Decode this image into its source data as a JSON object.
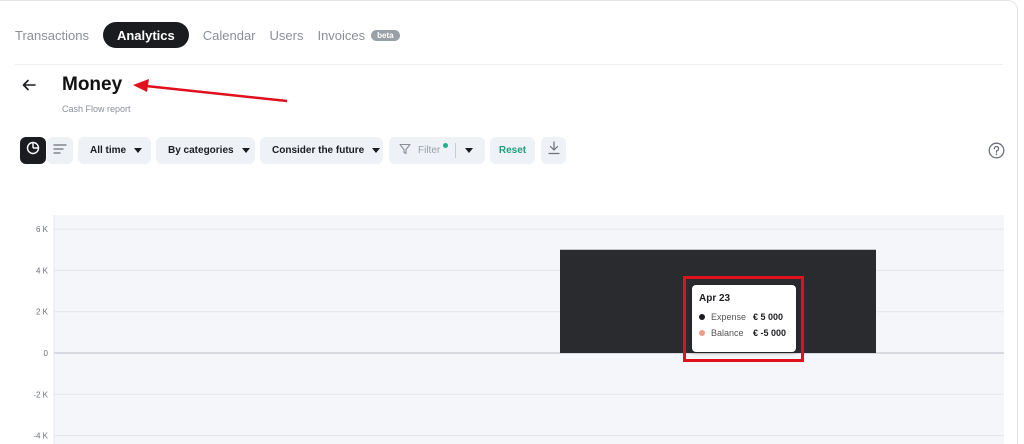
{
  "nav": {
    "items": [
      {
        "label": "Transactions",
        "active": false
      },
      {
        "label": "Analytics",
        "active": true
      },
      {
        "label": "Calendar",
        "active": false
      },
      {
        "label": "Users",
        "active": false
      },
      {
        "label": "Invoices",
        "active": false,
        "badge": "beta"
      }
    ]
  },
  "header": {
    "back_icon": "arrow-left-icon",
    "title": "Money",
    "subtitle": "Cash Flow report"
  },
  "toolbar": {
    "view_modes": [
      {
        "icon": "pie-chart-icon",
        "active": true
      },
      {
        "icon": "list-icon",
        "active": false
      }
    ],
    "dropdowns": [
      {
        "label": "All time"
      },
      {
        "label": "By categories"
      },
      {
        "label": "Consider the future"
      }
    ],
    "filter_label": "Filter",
    "filter_indicator_color": "#21b08a",
    "reset_label": "Reset",
    "download_icon": "download-icon",
    "help_icon": "help-circle-icon"
  },
  "colors": {
    "accent": "#21a07a",
    "expense": "#1b1c1f",
    "balance": "#ef9a8a",
    "annotation": "#e0101d"
  },
  "chart_data": {
    "type": "bar",
    "y_ticks": [
      "6 K",
      "4 K",
      "2 K",
      "0",
      "-2 K",
      "-4 K"
    ],
    "y_tick_values": [
      6000,
      4000,
      2000,
      0,
      -2000,
      -4000
    ],
    "ylim": [
      -4500,
      6500
    ],
    "grid": true,
    "categories": [
      "Apr 23"
    ],
    "series": [
      {
        "name": "Expense",
        "values": [
          5000
        ],
        "color": "#2a2b2e"
      }
    ],
    "tooltip": {
      "title": "Apr 23",
      "rows": [
        {
          "name": "Expense",
          "value": "€ 5 000",
          "color": "#1b1c1f"
        },
        {
          "name": "Balance",
          "value": "€ -5 000",
          "color": "#ef9a8a"
        }
      ]
    }
  }
}
